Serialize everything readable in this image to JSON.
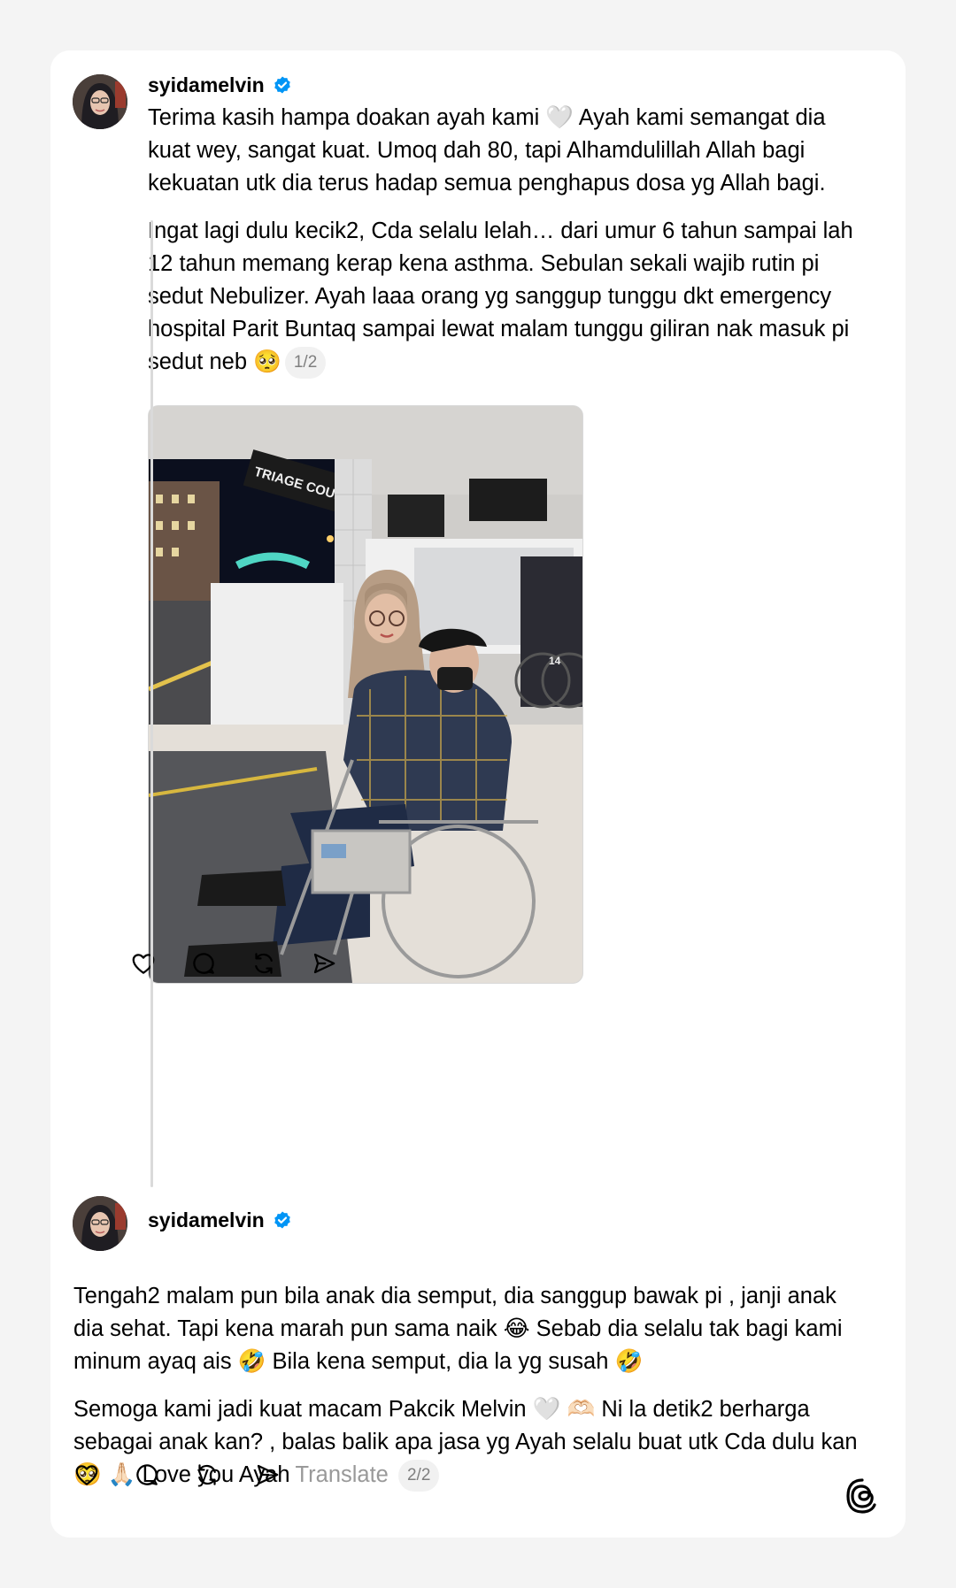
{
  "post1": {
    "username": "syidamelvin",
    "paragraph1": "Terima kasih hampa doakan ayah kami 🤍  Ayah kami semangat dia kuat wey, sangat kuat. Umoq dah 80, tapi Alhamdulillah Allah bagi kekuatan utk dia terus hadap semua penghapus dosa yg Allah bagi.",
    "paragraph2": "Ingat lagi dulu kecik2, Cda selalu lelah… dari umur 6 tahun sampai lah 12 tahun memang kerap kena asthma. Sebulan sekali wajib rutin pi sedut Nebulizer. Ayah laaa orang yg sanggup tunggu dkt emergency hospital Parit Buntaq sampai lewat malam tunggu giliran nak masuk pi sedut neb 🥺",
    "pager": "1/2",
    "photo_sign": "TRIAGE COUNTER",
    "photo_wheelchair_number": "14"
  },
  "post2": {
    "username": "syidamelvin",
    "paragraph1": "Tengah2 malam pun bila anak dia semput, dia sanggup bawak pi , janji anak dia sehat. Tapi kena marah pun sama naik 😂 Sebab dia selalu tak bagi kami minum ayaq ais 🤣 Bila kena semput, dia la yg susah 🤣",
    "paragraph2": "Semoga kami jadi kuat macam Pakcik Melvin 🤍 🫶🏻 Ni la detik2 berharga sebagai anak kan? , balas balik apa jasa yg Ayah selalu buat utk Cda dulu kan 🥺 🙏🏻 Love you Ayah",
    "translate": "Translate",
    "pager": "2/2"
  },
  "icons": {
    "like": "heart-icon",
    "reply": "comment-icon",
    "repost": "repost-icon",
    "share": "send-icon",
    "verified": "verified-badge-icon",
    "brand": "threads-logo-icon"
  },
  "colors": {
    "verified": "#0095f6",
    "thread_line": "#dadada",
    "muted": "#999999"
  }
}
